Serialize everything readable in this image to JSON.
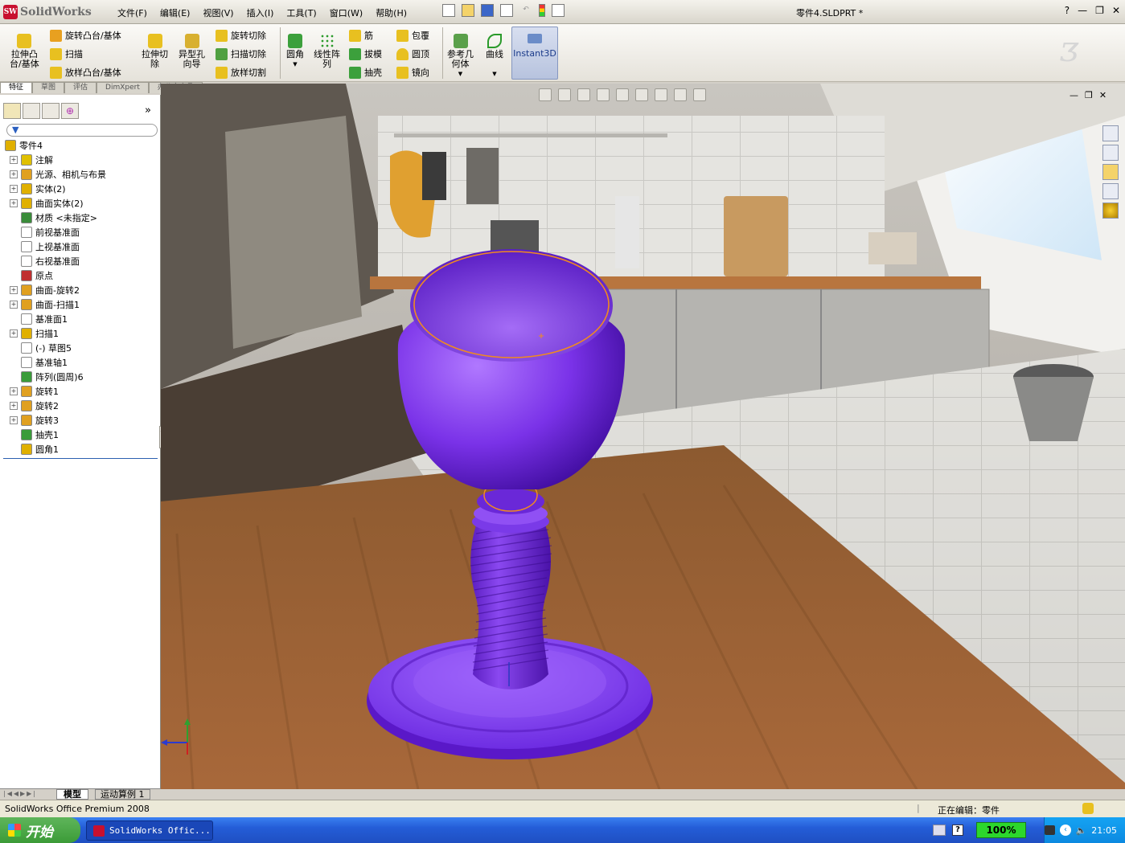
{
  "app": {
    "logo_text": "SolidWorks",
    "logo_badge": "SW",
    "document_title": "零件4.SLDPRT *"
  },
  "menu": [
    "文件(F)",
    "编辑(E)",
    "视图(V)",
    "插入(I)",
    "工具(T)",
    "窗口(W)",
    "帮助(H)"
  ],
  "window_controls": {
    "help": "?",
    "minimize": "—",
    "restore": "❐",
    "close": "✕"
  },
  "commands": {
    "extrude_boss": "拉伸凸\n台/基体",
    "revolve_boss": "旋转凸台/基体",
    "sweep": "扫描",
    "loft_boss": "放样凸台/基体",
    "extrude_cut": "拉伸切\n除",
    "hole_wizard": "异型孔\n向导",
    "revolve_cut": "旋转切除",
    "sweep_cut": "扫描切除",
    "loft_cut": "放样切割",
    "fillet": "圆角",
    "linear_pattern": "线性阵\n列",
    "rib": "筋",
    "draft": "拔模",
    "shell": "抽壳",
    "wrap": "包覆",
    "dome": "圆顶",
    "mirror": "镜向",
    "ref_geometry": "参考几\n何体",
    "curves": "曲线",
    "instant3d": "Instant3D"
  },
  "cmd_tabs": [
    "特征",
    "草图",
    "评估",
    "DimXpert",
    "办公室产品"
  ],
  "tree": [
    {
      "label": "零件4",
      "expand": "",
      "color": "#e0b000",
      "root": true
    },
    {
      "label": "注解",
      "expand": "+",
      "color": "#e0c000"
    },
    {
      "label": "光源、相机与布景",
      "expand": "+",
      "color": "#e0a020"
    },
    {
      "label": "实体(2)",
      "expand": "+",
      "color": "#e0b000"
    },
    {
      "label": "曲面实体(2)",
      "expand": "+",
      "color": "#e0b000"
    },
    {
      "label": "材质 <未指定>",
      "expand": "",
      "color": "#3a8c3a"
    },
    {
      "label": "前视基准面",
      "expand": "",
      "color": "#ffffff"
    },
    {
      "label": "上视基准面",
      "expand": "",
      "color": "#ffffff"
    },
    {
      "label": "右视基准面",
      "expand": "",
      "color": "#ffffff"
    },
    {
      "label": "原点",
      "expand": "",
      "color": "#c03030"
    },
    {
      "label": "曲面-旋转2",
      "expand": "+",
      "color": "#e0a020"
    },
    {
      "label": "曲面-扫描1",
      "expand": "+",
      "color": "#e0a020"
    },
    {
      "label": "基准面1",
      "expand": "",
      "color": "#ffffff"
    },
    {
      "label": "扫描1",
      "expand": "+",
      "color": "#e0b000"
    },
    {
      "label": "(-) 草图5",
      "expand": "",
      "color": "#ffffff"
    },
    {
      "label": "基准轴1",
      "expand": "",
      "color": "#ffffff"
    },
    {
      "label": "阵列(圆周)6",
      "expand": "",
      "color": "#3a9c3a"
    },
    {
      "label": "旋转1",
      "expand": "+",
      "color": "#e0a020"
    },
    {
      "label": "旋转2",
      "expand": "+",
      "color": "#e0a020"
    },
    {
      "label": "旋转3",
      "expand": "+",
      "color": "#e0a020"
    },
    {
      "label": "抽壳1",
      "expand": "",
      "color": "#3a9c3a"
    },
    {
      "label": "圆角1",
      "expand": "",
      "color": "#e0b000"
    }
  ],
  "left_bottom_tabs": [
    "模型",
    "运动算例 1"
  ],
  "status": {
    "left": "SolidWorks Office Premium 2008",
    "editing": "正在编辑：零件"
  },
  "taskbar": {
    "start": "开始",
    "task_item": "SolidWorks Offic...",
    "zoom": "100%",
    "time": "21:05"
  },
  "colors": {
    "model": "#8b3df0",
    "model_dark": "#5a16c8",
    "edge_highlight": "#f08a20"
  }
}
